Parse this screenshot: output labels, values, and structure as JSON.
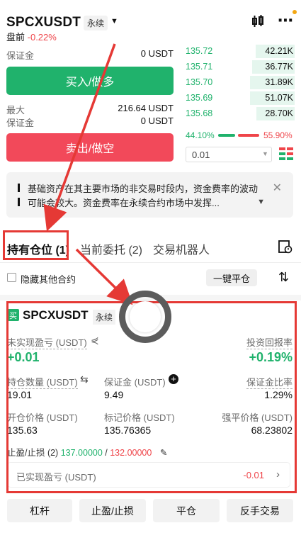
{
  "header": {
    "symbol": "SPCXUSDT",
    "contract_type": "永续",
    "session_label": "盘前",
    "change": "-0.22%"
  },
  "left_panel": {
    "margin_label_1": "保证金",
    "margin_value_1": "0 USDT",
    "buy_label": "买入/做多",
    "max_label": "最大",
    "max_value": "216.64 USDT",
    "margin_label_2": "保证金",
    "margin_value_2": "0 USDT",
    "sell_label": "卖出/做空"
  },
  "order_book": {
    "rows": [
      {
        "price": "135.72",
        "qty": "42.21K",
        "depth": 0.35
      },
      {
        "price": "135.71",
        "qty": "36.77K",
        "depth": 0.38
      },
      {
        "price": "135.70",
        "qty": "31.89K",
        "depth": 0.4
      },
      {
        "price": "135.69",
        "qty": "51.07K",
        "depth": 0.4
      },
      {
        "price": "135.68",
        "qty": "28.70K",
        "depth": 0.34
      }
    ],
    "buy_ratio": "44.10%",
    "sell_ratio": "55.90%",
    "tick_size": "0.01"
  },
  "notice": {
    "text": "基础资产在其主要市场的非交易时段内，资金费率的波动可能会较大。资金费率在永续合约市场中发挥..."
  },
  "tabs": {
    "positions": "持有仓位 (1)",
    "open_orders": "当前委托 (2)",
    "bots": "交易机器人"
  },
  "filters": {
    "hide_others": "隐藏其他合约",
    "close_all": "一键平仓"
  },
  "position": {
    "side_badge": "买",
    "symbol": "SPCXUSDT",
    "contract_type": "永续",
    "unrealized_pnl_label": "未实现盈亏 (USDT)",
    "unrealized_pnl": "+0.01",
    "roi_label": "投资回报率",
    "roi": "+0.19%",
    "size_label": "持仓数量 (USDT)",
    "size": "19.01",
    "margin_label": "保证金 (USDT)",
    "margin": "9.49",
    "margin_ratio_label": "保证金比率",
    "margin_ratio": "1.29%",
    "entry_label": "开仓价格 (USDT)",
    "entry": "135.63",
    "mark_label": "标记价格 (USDT)",
    "mark": "135.76365",
    "liq_label": "强平价格 (USDT)",
    "liq": "68.23802",
    "tpsl_label": "止盈/止损 (2)",
    "tp": "137.00000",
    "sl": "132.00000",
    "realized_label": "已实现盈亏 (USDT)",
    "realized": "-0.01"
  },
  "actions": {
    "leverage": "杠杆",
    "tpsl": "止盈/止损",
    "close": "平仓",
    "reverse": "反手交易"
  }
}
